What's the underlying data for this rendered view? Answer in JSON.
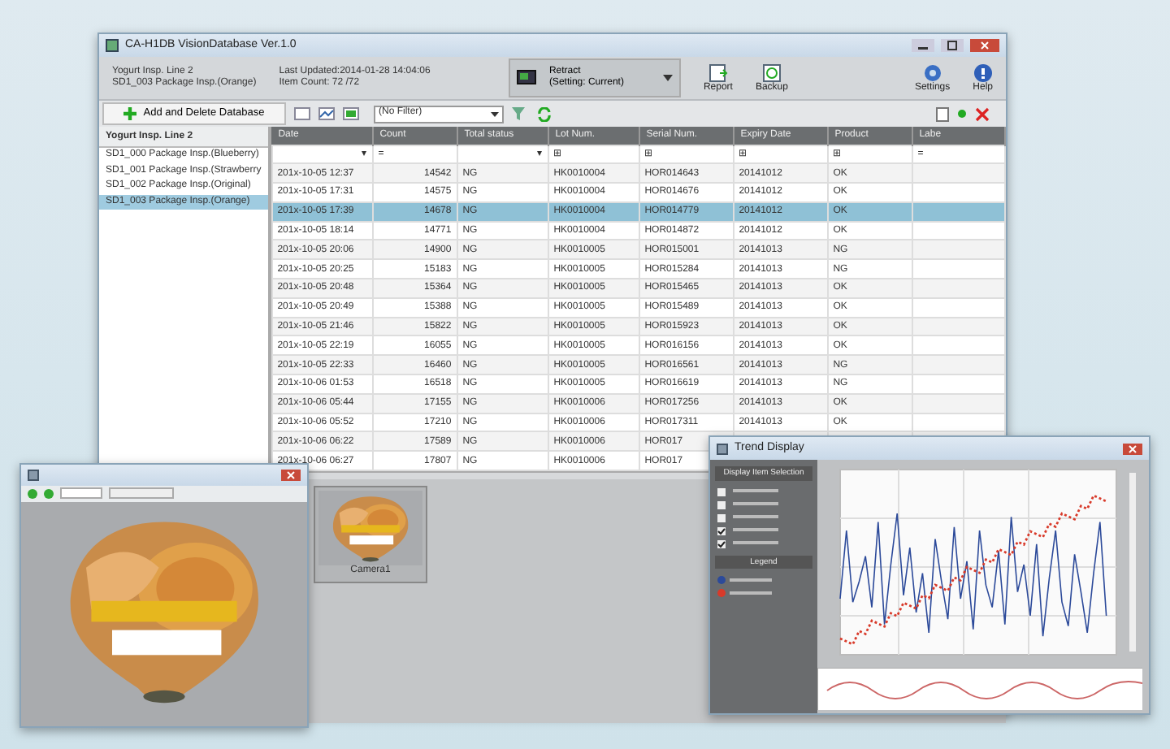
{
  "main_window": {
    "title": "CA-H1DB VisionDatabase Ver.1.0",
    "header": {
      "line": "Yogurt Insp. Line 2",
      "inspection": "SD1_003 Package Insp.(Orange)",
      "last_updated": "Last Updated:2014-01-28 14:04:06",
      "item_count": "Item Count:  72 /72",
      "mode": "Retract",
      "mode_setting": "(Setting: Current)"
    },
    "tool_buttons": [
      {
        "kind": "report",
        "label": "Report"
      },
      {
        "kind": "backup",
        "label": "Backup"
      },
      {
        "kind": "settings",
        "label": "Settings"
      },
      {
        "kind": "help",
        "label": "Help"
      }
    ],
    "add_button": "Add and Delete Database",
    "filter": "(No Filter)",
    "tree": {
      "title": "Yogurt Insp. Line 2",
      "items": [
        {
          "label": "SD1_000 Package Insp.(Blueberry)",
          "selected": false
        },
        {
          "label": "SD1_001 Package Insp.(Strawberry",
          "selected": false
        },
        {
          "label": "SD1_002 Package Insp.(Original)",
          "selected": false
        },
        {
          "label": "SD1_003 Package Insp.(Orange)",
          "selected": true
        }
      ]
    },
    "table": {
      "columns": [
        "Date",
        "Count",
        "Total status",
        "Lot Num.",
        "Serial Num.",
        "Expiry Date",
        "Product",
        "Labe"
      ],
      "filters": [
        "▾",
        "=",
        "▾",
        "⊞",
        "⊞",
        "⊞",
        "⊞",
        "="
      ],
      "rows": [
        {
          "cells": [
            "201x-10-05 12:37",
            "14542",
            "NG",
            "HK0010004",
            "HOR014643",
            "20141012",
            "OK"
          ],
          "selected": false
        },
        {
          "cells": [
            "201x-10-05 17:31",
            "14575",
            "NG",
            "HK0010004",
            "HOR014676",
            "20141012",
            "OK"
          ],
          "selected": false
        },
        {
          "cells": [
            "201x-10-05 17:39",
            "14678",
            "NG",
            "HK0010004",
            "HOR014779",
            "20141012",
            "OK"
          ],
          "selected": true
        },
        {
          "cells": [
            "201x-10-05 18:14",
            "14771",
            "NG",
            "HK0010004",
            "HOR014872",
            "20141012",
            "OK"
          ],
          "selected": false
        },
        {
          "cells": [
            "201x-10-05 20:06",
            "14900",
            "NG",
            "HK0010005",
            "HOR015001",
            "20141013",
            "NG"
          ],
          "selected": false
        },
        {
          "cells": [
            "201x-10-05 20:25",
            "15183",
            "NG",
            "HK0010005",
            "HOR015284",
            "20141013",
            "NG"
          ],
          "selected": false
        },
        {
          "cells": [
            "201x-10-05 20:48",
            "15364",
            "NG",
            "HK0010005",
            "HOR015465",
            "20141013",
            "OK"
          ],
          "selected": false
        },
        {
          "cells": [
            "201x-10-05 20:49",
            "15388",
            "NG",
            "HK0010005",
            "HOR015489",
            "20141013",
            "OK"
          ],
          "selected": false
        },
        {
          "cells": [
            "201x-10-05 21:46",
            "15822",
            "NG",
            "HK0010005",
            "HOR015923",
            "20141013",
            "OK"
          ],
          "selected": false
        },
        {
          "cells": [
            "201x-10-05 22:19",
            "16055",
            "NG",
            "HK0010005",
            "HOR016156",
            "20141013",
            "OK"
          ],
          "selected": false
        },
        {
          "cells": [
            "201x-10-05 22:33",
            "16460",
            "NG",
            "HK0010005",
            "HOR016561",
            "20141013",
            "NG"
          ],
          "selected": false
        },
        {
          "cells": [
            "201x-10-06 01:53",
            "16518",
            "NG",
            "HK0010005",
            "HOR016619",
            "20141013",
            "NG"
          ],
          "selected": false
        },
        {
          "cells": [
            "201x-10-06 05:44",
            "17155",
            "NG",
            "HK0010006",
            "HOR017256",
            "20141013",
            "OK"
          ],
          "selected": false
        },
        {
          "cells": [
            "201x-10-06 05:52",
            "17210",
            "NG",
            "HK0010006",
            "HOR017311",
            "20141013",
            "OK"
          ],
          "selected": false
        },
        {
          "cells": [
            "201x-10-06 06:22",
            "17589",
            "NG",
            "HK0010006",
            "HOR017"
          ],
          "selected": false
        },
        {
          "cells": [
            "201x-10-06 06:27",
            "17807",
            "NG",
            "HK0010006",
            "HOR017"
          ],
          "selected": false
        }
      ]
    },
    "thumbnail": {
      "kind": "picture",
      "label": "Camera1"
    }
  },
  "trend_window": {
    "title": "Trend Display",
    "selection_heading": "Display Item Selection",
    "options": [
      {
        "checked": false
      },
      {
        "checked": false
      },
      {
        "checked": false
      },
      {
        "checked": true
      },
      {
        "checked": true
      }
    ],
    "legend_heading": "Legend"
  }
}
